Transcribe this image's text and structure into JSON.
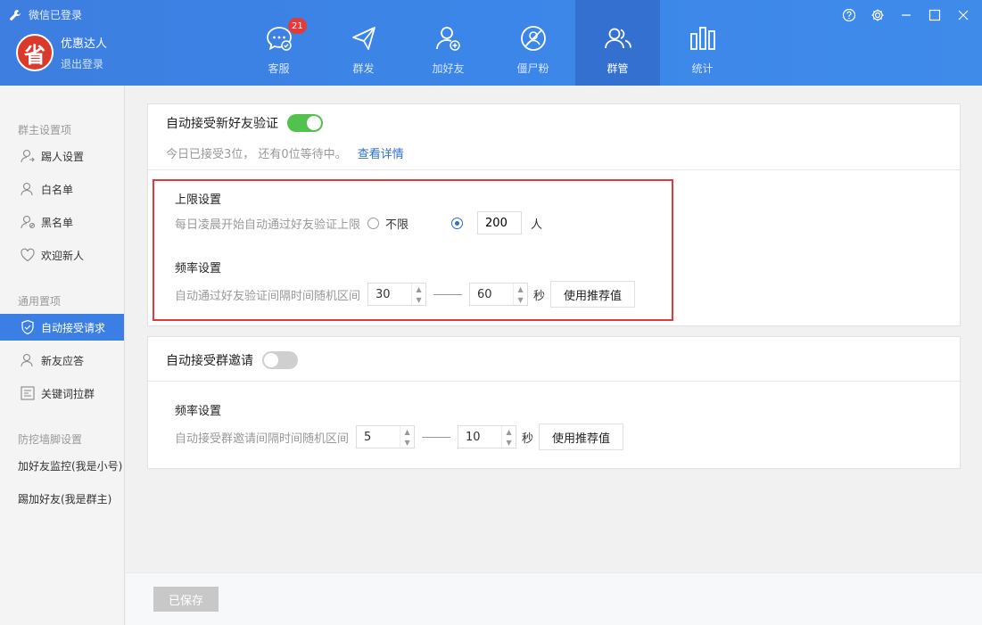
{
  "header": {
    "status": "微信已登录",
    "user_name": "优惠达人",
    "logout": "退出登录",
    "avatar_char": "省",
    "nav": [
      {
        "label": "客服",
        "icon": "chat-icon",
        "badge": "21"
      },
      {
        "label": "群发",
        "icon": "send-icon"
      },
      {
        "label": "加好友",
        "icon": "add-friend-icon"
      },
      {
        "label": "僵尸粉",
        "icon": "zombie-fan-icon"
      },
      {
        "label": "群管",
        "icon": "group-manage-icon",
        "active": true
      },
      {
        "label": "统计",
        "icon": "stats-icon"
      }
    ]
  },
  "sidebar": {
    "group1": "群主设置项",
    "items1": [
      {
        "label": "踢人设置",
        "icon": "kick-user-icon"
      },
      {
        "label": "白名单",
        "icon": "whitelist-icon"
      },
      {
        "label": "黑名单",
        "icon": "blacklist-icon"
      },
      {
        "label": "欢迎新人",
        "icon": "heart-icon"
      }
    ],
    "group2": "通用置项",
    "items2": [
      {
        "label": "自动接受请求",
        "icon": "shield-icon",
        "active": true
      },
      {
        "label": "新友应答",
        "icon": "new-friend-icon"
      },
      {
        "label": "关键词拉群",
        "icon": "keyword-icon"
      }
    ],
    "group3": "防挖墙脚设置",
    "items3": [
      {
        "label": "加好友监控(我是小号)"
      },
      {
        "label": "踢加好友(我是群主)"
      }
    ]
  },
  "card1": {
    "title": "自动接受新好友验证",
    "toggle_on": true,
    "summary": "今日已接受3位， 还有0位等待中。",
    "details_link": "查看详情",
    "limit": {
      "title": "上限设置",
      "desc": "每日凌晨开始自动通过好友验证上限",
      "option_unlimited": "不限",
      "value": "200",
      "unit": "人"
    },
    "freq": {
      "title": "频率设置",
      "desc": "自动通过好友验证间隔时间随机区间",
      "min": "30",
      "max": "60",
      "unit": "秒",
      "recommend": "使用推荐值"
    }
  },
  "card2": {
    "title": "自动接受群邀请",
    "toggle_on": false,
    "freq": {
      "title": "频率设置",
      "desc": "自动接受群邀请间隔时间随机区间",
      "min": "5",
      "max": "10",
      "unit": "秒",
      "recommend": "使用推荐值"
    }
  },
  "footer": {
    "save": "已保存"
  },
  "colors": {
    "header_blue": "#3b86e8",
    "active_blue": "#3b7fe4",
    "toggle_green": "#53c14d",
    "badge_red": "#e23b3b",
    "highlight_red": "#e03a3a",
    "link_blue": "#2d6fd1"
  }
}
